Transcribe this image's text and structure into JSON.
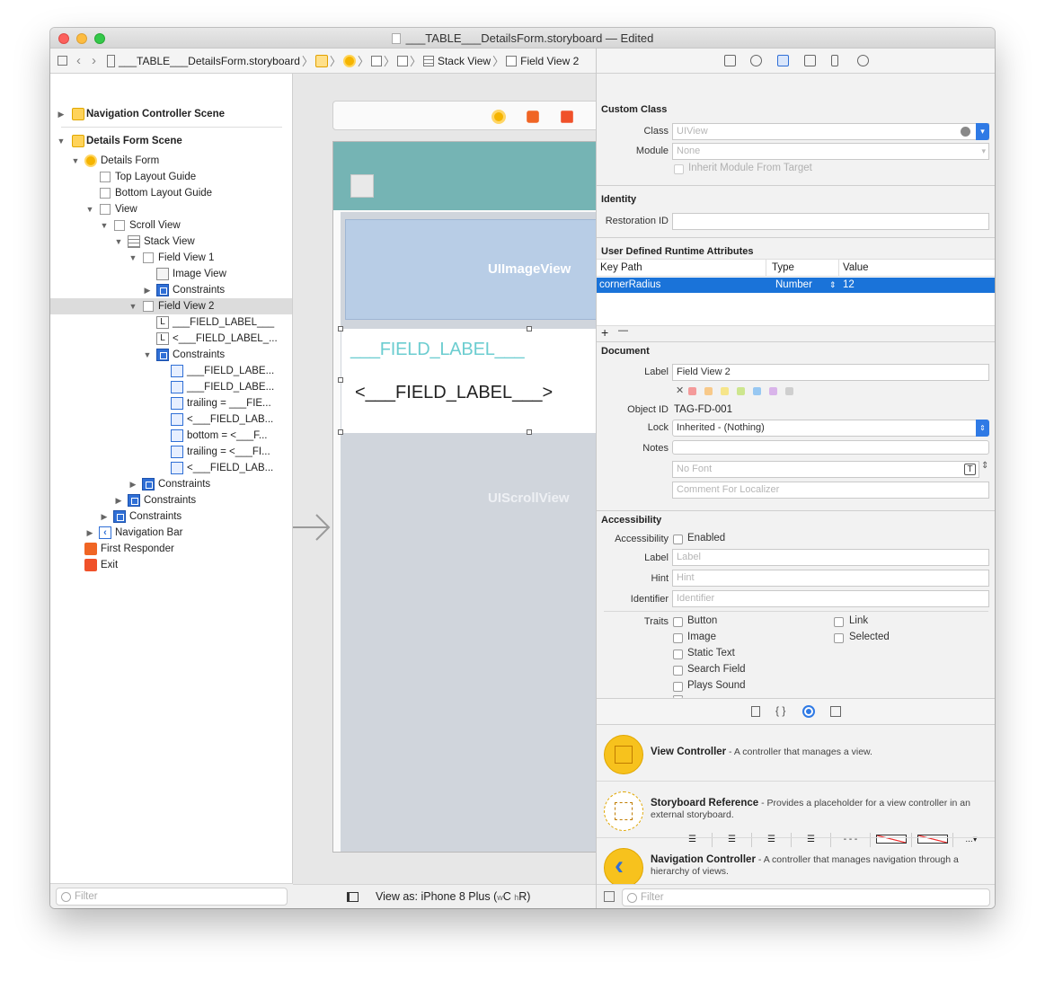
{
  "window": {
    "title": "___TABLE___DetailsForm.storyboard — Edited"
  },
  "jumpbar": {
    "file": "___TABLE___DetailsForm.storyboard",
    "crumb_stack": "Stack View",
    "crumb_field": "Field View 2"
  },
  "outline": {
    "nav_scene": "Navigation Controller Scene",
    "details_scene": "Details Form Scene",
    "details_form": "Details Form",
    "top_guide": "Top Layout Guide",
    "bottom_guide": "Bottom Layout Guide",
    "view": "View",
    "scroll_view": "Scroll View",
    "stack_view": "Stack View",
    "field_view_1": "Field View 1",
    "image_view": "Image View",
    "constraints": "Constraints",
    "field_view_2": "Field View 2",
    "label_a": "___FIELD_LABEL___",
    "label_b": "<___FIELD_LABEL_...",
    "c1": "___FIELD_LABE...",
    "c2": "___FIELD_LABE...",
    "c3": "trailing = ___FIE...",
    "c4": "<___FIELD_LAB...",
    "c5": "bottom = <___F...",
    "c6": "trailing = <___FI...",
    "c7": "<___FIELD_LAB...",
    "navigation_bar": "Navigation Bar",
    "first_responder": "First Responder",
    "exit": "Exit",
    "filter_placeholder": "Filter"
  },
  "canvas": {
    "uiimageview": "UIImageView",
    "field_label_top": "___FIELD_LABEL___",
    "field_label_bottom": "<___FIELD_LABEL___>",
    "uiscrollview": "UIScrollView",
    "view_as": "View as: iPhone 8 Plus (",
    "view_as_w": "w",
    "view_as_c": "C ",
    "view_as_h": "h",
    "view_as_r": "R)",
    "nav_color": "#75b4b4",
    "accent_label_color": "#6ccdd0"
  },
  "inspector": {
    "custom_class": "Custom Class",
    "class_label": "Class",
    "class_value": "UIView",
    "module_label": "Module",
    "module_value": "None",
    "inherit_label": "Inherit Module From Target",
    "identity": "Identity",
    "restoration_label": "Restoration ID",
    "uda_title": "User Defined Runtime Attributes",
    "col_key": "Key Path",
    "col_type": "Type",
    "col_value": "Value",
    "row_key": "cornerRadius",
    "row_type": "Number",
    "row_value": "12",
    "plus": "+",
    "minus": "—",
    "document": "Document",
    "doc_label": "Label",
    "doc_label_value": "Field View 2",
    "object_id_label": "Object ID",
    "object_id_value": "TAG-FD-001",
    "lock_label": "Lock",
    "lock_value": "Inherited - (Nothing)",
    "notes_label": "Notes",
    "no_font": "No Font",
    "comment_placeholder": "Comment For Localizer",
    "accessibility": "Accessibility",
    "acc_label": "Accessibility",
    "enabled": "Enabled",
    "label_label": "Label",
    "label_placeholder": "Label",
    "hint_label": "Hint",
    "hint_placeholder": "Hint",
    "identifier_label": "Identifier",
    "identifier_placeholder": "Identifier",
    "traits": "Traits",
    "trait_button": "Button",
    "trait_link": "Link",
    "trait_image": "Image",
    "trait_selected": "Selected",
    "trait_static": "Static Text",
    "trait_search": "Search Field",
    "trait_sound": "Plays Sound",
    "filter_placeholder": "Filter"
  },
  "library": [
    {
      "name": "View Controller",
      "desc": " - A controller that manages a view."
    },
    {
      "name": "Storyboard Reference",
      "desc": " - Provides a placeholder for a view controller in an external storyboard."
    },
    {
      "name": "Navigation Controller",
      "desc": " - A controller that manages navigation through a hierarchy of views."
    }
  ]
}
